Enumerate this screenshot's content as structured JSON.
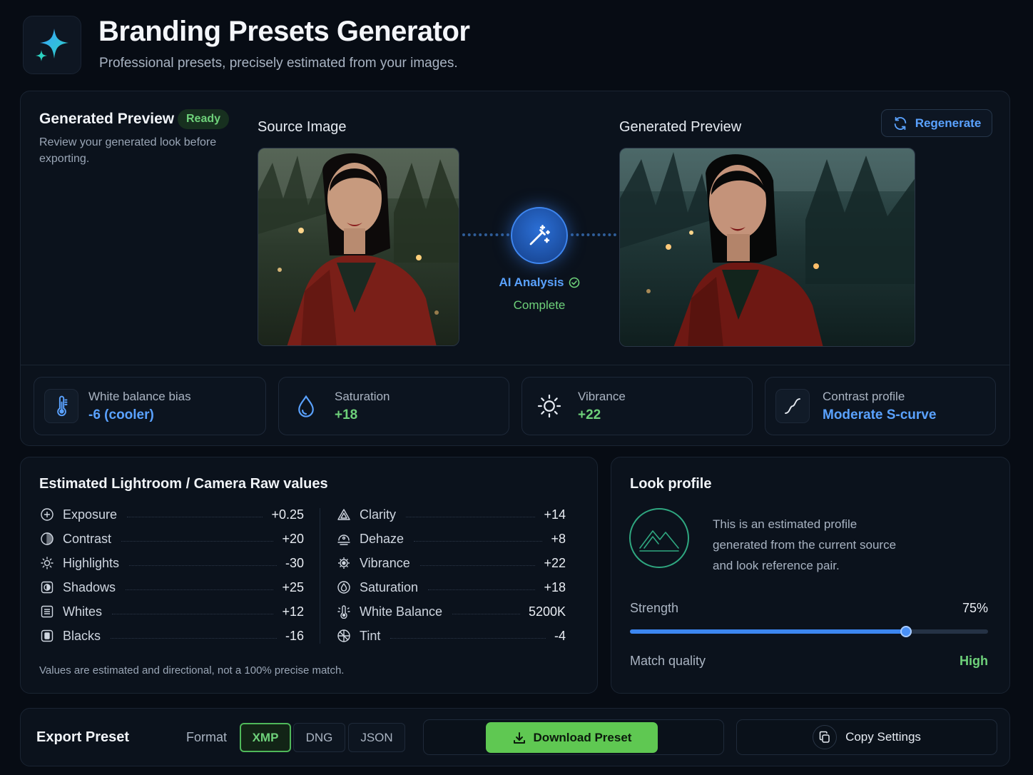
{
  "header": {
    "title": "Branding Presets Generator",
    "subtitle": "Professional presets, precisely estimated from your images.",
    "logo_icon": "sparkle-icon"
  },
  "preview": {
    "title": "Generated Preview",
    "badge": "Ready",
    "description": "Review your generated look before exporting.",
    "source_label": "Source Image",
    "generated_label": "Generated Preview",
    "regenerate_label": "Regenerate",
    "ai_label": "AI Analysis",
    "ai_status": "Complete"
  },
  "stats": [
    {
      "name": "White balance bias",
      "value": "-6 (cooler)",
      "icon": "thermometer-icon",
      "color": "#5aa2ff"
    },
    {
      "name": "Saturation",
      "value": "+18",
      "icon": "droplet-icon",
      "color": "#6ed17a"
    },
    {
      "name": "Vibrance",
      "value": "+22",
      "icon": "sun-icon",
      "color": "#6ed17a"
    },
    {
      "name": "Contrast profile",
      "value": "Moderate S-curve",
      "icon": "curve-icon",
      "color": "#5aa2ff"
    }
  ],
  "values": {
    "title": "Estimated Lightroom / Camera Raw values",
    "left": [
      {
        "label": "Exposure",
        "value": "+0.25",
        "icon": "exposure-icon"
      },
      {
        "label": "Contrast",
        "value": "+20",
        "icon": "contrast-icon"
      },
      {
        "label": "Highlights",
        "value": "-30",
        "icon": "highlights-icon"
      },
      {
        "label": "Shadows",
        "value": "+25",
        "icon": "shadows-icon"
      },
      {
        "label": "Whites",
        "value": "+12",
        "icon": "whites-icon"
      },
      {
        "label": "Blacks",
        "value": "-16",
        "icon": "blacks-icon"
      }
    ],
    "right": [
      {
        "label": "Clarity",
        "value": "+14",
        "icon": "clarity-icon"
      },
      {
        "label": "Dehaze",
        "value": "+8",
        "icon": "dehaze-icon"
      },
      {
        "label": "Vibrance",
        "value": "+22",
        "icon": "vibrance-icon"
      },
      {
        "label": "Saturation",
        "value": "+18",
        "icon": "saturation-icon"
      },
      {
        "label": "White Balance",
        "value": "5200K",
        "icon": "white-balance-icon"
      },
      {
        "label": "Tint",
        "value": "-4",
        "icon": "tint-icon"
      }
    ],
    "note": "Values are estimated and directional, not a 100% precise match."
  },
  "look": {
    "title": "Look profile",
    "description": "This is an estimated profile generated from the current source and look reference pair.",
    "strength_label": "Strength",
    "strength_value": "75%",
    "strength_fraction": 0.77,
    "match_label": "Match quality",
    "match_value": "High"
  },
  "export": {
    "title": "Export Preset",
    "format_label": "Format",
    "formats": [
      "XMP",
      "DNG",
      "JSON"
    ],
    "selected_format": "XMP",
    "download_label": "Download Preset",
    "copy_label": "Copy Settings"
  }
}
